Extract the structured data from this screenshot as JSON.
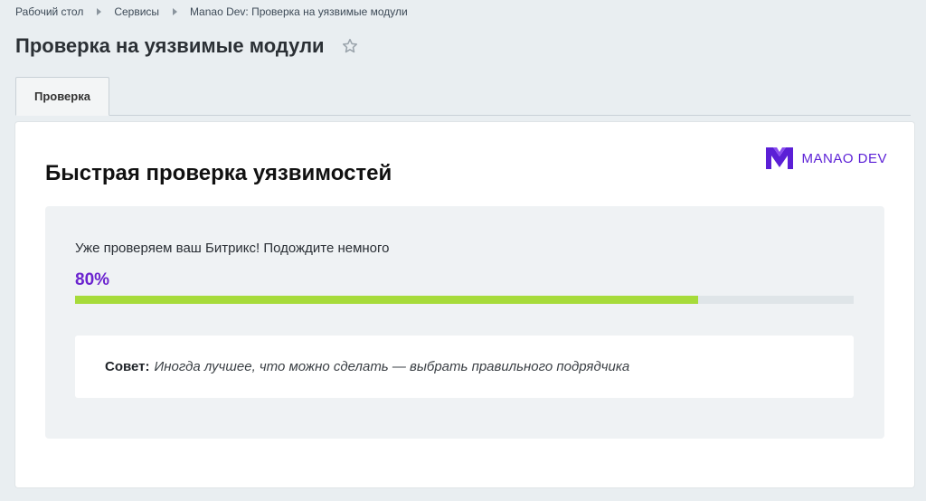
{
  "breadcrumbs": [
    {
      "label": "Рабочий стол"
    },
    {
      "label": "Сервисы"
    },
    {
      "label": "Manao Dev: Проверка на уязвимые модули"
    }
  ],
  "page": {
    "title": "Проверка на уязвимые модули",
    "favorite_icon": "star-outline-icon"
  },
  "tabs": [
    {
      "label": "Проверка",
      "active": true
    }
  ],
  "brand": {
    "icon": "manao-logo-icon",
    "text": "MANAO DEV",
    "color": "#5b1fd6"
  },
  "check": {
    "title": "Быстрая проверка уязвимостей",
    "status": "Уже проверяем ваш Битрикс! Подождите немного",
    "percent_label": "80%",
    "progress": 0.8,
    "accent_color": "#6b24cf",
    "bar_color": "#a6db3a"
  },
  "tip": {
    "label": "Совет:",
    "text": "Иногда лучшее, что можно сделать — выбрать правильного подрядчика"
  }
}
